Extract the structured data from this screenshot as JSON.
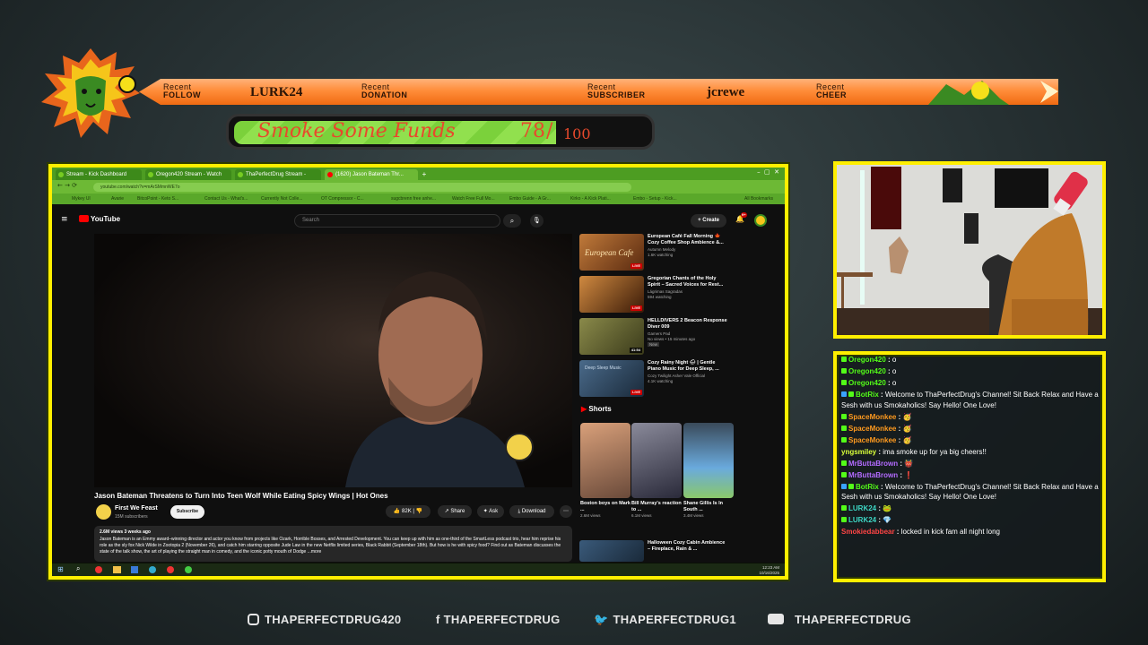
{
  "alerts": {
    "follow": {
      "line1": "Recent",
      "line2": "FOLLOW",
      "name": "LURK24"
    },
    "donation": {
      "line1": "Recent",
      "line2": "DONATION",
      "name": ""
    },
    "subscriber": {
      "line1": "Recent",
      "line2": "SUBSCRIBER",
      "name": "jcrewe"
    },
    "cheer": {
      "line1": "Recent",
      "line2": "CHEER",
      "name": ""
    }
  },
  "goal": {
    "title": "Smoke Some Funds",
    "current": "78",
    "slash": "/",
    "target": "100",
    "progress": 0.78
  },
  "browser": {
    "tabs": [
      "Stream - Kick Dashboard",
      "Oregon420 Stream - Watch Li...",
      "ThaPerfectDrug Stream - Watc...",
      "(1620) Jason Bateman Thr..."
    ],
    "url": "youtube.com/watch?v=mArSMmnWE7o",
    "bookmarks": [
      "Mykey Ul",
      "Avarie",
      "BitcoPoint - Keto S...",
      "Contact Us - What's...",
      "Currently Not Colle...",
      "OT Compressor - C...",
      "sugcbrenn free anhe...",
      "Watch Free Full Mo...",
      "Embo Guide - A Gr...",
      "Kirko - A Kick Plati...",
      "Embo - Setup - Kick...",
      "All Bookmarks"
    ]
  },
  "youtube": {
    "logo": "YouTube",
    "search_placeholder": "Search",
    "create": "+ Create",
    "notif_count": "9+",
    "video_title": "Jason Bateman Threatens to Turn Into Teen Wolf While Eating Spicy Wings | Hot Ones",
    "channel": "First We Feast",
    "subs": "15M subscribers",
    "subscribe": "Subscribe",
    "likes": "82K",
    "share": "Share",
    "ask": "Ask",
    "download": "Download",
    "desc_meta": "2.6M views  3 weeks ago",
    "description": "Jason Bateman is an Emmy award–winning director and actor you know from projects like Ozark, Horrible Bosses, and Arrested Development. You can keep up with him as one-third of the SmartLess podcast trio, hear him reprise his role as the sly fox Nick Wilde in Zootopia 2 (November 26), and catch him starring opposite Jude Law in the new Netflix limited series, Black Rabbit (September 18th). But how is he with spicy food? Find out as Bateman discusses the state of the talk show, the art of playing the straight man in comedy, and the iconic potty mouth of Dodge ...more",
    "recommended": [
      {
        "title": "European Café Fall Morning 🍁 Cozy Coffee Shop Ambience &...",
        "channel": "Autumn Melody",
        "meta": "1.6K watching",
        "badge": "LIVE",
        "thumb_text": "European Cafe",
        "color": "#8a4a1c"
      },
      {
        "title": "Gregorian Chants of the Holy Spirit – Sacred Voices for Rest...",
        "channel": "Lágrimas Sagradas",
        "meta": "594 watching",
        "badge": "LIVE",
        "thumb_text": "",
        "color": "#6a3a14"
      },
      {
        "title": "HELLDIVERS 2 Beacon Response Diver 009",
        "channel": "Gamers Pad",
        "meta": "No views • 15 minutes ago",
        "badge": "41:54",
        "extra": "New",
        "thumb_text": "",
        "color": "#5a5a2c"
      },
      {
        "title": "Cozy Rainy Night 🌧 | Gentle Piano Music for Deep Sleep, ...",
        "channel": "Cozy Twilight Asher Vale Official",
        "meta": "4.1K watching",
        "badge": "LIVE",
        "thumb_text": "Deep Sleep Music",
        "color": "#2c3c4c"
      }
    ],
    "shorts_heading": "Shorts",
    "shorts": [
      {
        "title": "Boston boys on Mark ...",
        "views": "2.6M views",
        "color": "#b57a5a"
      },
      {
        "title": "Bill Murray's reaction to ...",
        "views": "6.1M views",
        "color": "#4a4a5a"
      },
      {
        "title": "Shane Gillis Is In South ...",
        "views": "3.4M views",
        "color": "#6a8aaa"
      }
    ],
    "bottom_rec": {
      "title": "Halloween Cozy Cabin Ambience – Fireplace, Rain & ..."
    }
  },
  "taskbar": {
    "time": "12:23 AM",
    "date": "10/16/2025"
  },
  "chat": [
    {
      "user": "Oregon420",
      "text": "o",
      "color": "#53fc18",
      "badges": 1
    },
    {
      "user": "Oregon420",
      "text": "o",
      "color": "#53fc18",
      "badges": 1
    },
    {
      "user": "Oregon420",
      "text": "o",
      "color": "#53fc18",
      "badges": 1
    },
    {
      "user": "BotRix",
      "text": "Welcome to ThaPerfectDrug's Channel! Sit Back Relax and Have a Sesh with us Smokaholics! Say Hello! One Love!",
      "color": "#53fc18",
      "badges": 2
    },
    {
      "user": "SpaceMonkee",
      "text": "🥳",
      "color": "#ff9a1f",
      "badges": 1
    },
    {
      "user": "SpaceMonkee",
      "text": "🥳",
      "color": "#ff9a1f",
      "badges": 1
    },
    {
      "user": "SpaceMonkee",
      "text": "🥳",
      "color": "#ff9a1f",
      "badges": 1
    },
    {
      "user": "yngsmiley",
      "text": "ima smoke up for ya big cheers!!",
      "color": "#d9ff3a",
      "badges": 0
    },
    {
      "user": "MrButtaBrown",
      "text": "👹",
      "color": "#b36bff",
      "badges": 1
    },
    {
      "user": "MrButtaBrown",
      "text": "❗",
      "color": "#b36bff",
      "badges": 1
    },
    {
      "user": "BotRix",
      "text": "Welcome to ThaPerfectDrug's Channel! Sit Back Relax and Have a Sesh with us Smokaholics! Say Hello! One Love!",
      "color": "#53fc18",
      "badges": 2
    },
    {
      "user": "LURK24",
      "text": "🐸",
      "color": "#3dd6c4",
      "badges": 1
    },
    {
      "user": "LURK24",
      "text": "💎",
      "color": "#3dd6c4",
      "badges": 1
    },
    {
      "user": "Smokiedabbear",
      "text": "locked in kick fam all night long",
      "color": "#ff4545",
      "badges": 0
    }
  ],
  "socials": [
    {
      "icon": "instagram-icon",
      "handle": "THAPERFECTDRUG420"
    },
    {
      "icon": "facebook-icon",
      "handle": "THAPERFECTDRUG"
    },
    {
      "icon": "twitter-icon",
      "handle": "THAPERFECTDRUG1"
    },
    {
      "icon": "youtube-icon",
      "handle": "THAPERFECTDRUG"
    }
  ]
}
